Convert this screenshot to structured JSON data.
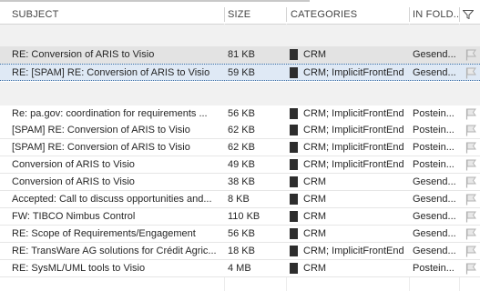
{
  "columns": {
    "subject": "SUBJECT",
    "size": "SIZE",
    "categories": "CATEGORIES",
    "in_folder": "IN FOLD..."
  },
  "rows": [
    {
      "subject": "RE: Conversion of ARIS to Visio",
      "size": "81 KB",
      "categories": "CRM",
      "folder": "Gesend...",
      "style": "grey"
    },
    {
      "subject": "RE: [SPAM]  RE: Conversion of ARIS to Visio",
      "size": "59 KB",
      "categories": "CRM; ImplicitFrontEnd",
      "folder": "Gesend...",
      "style": "selected"
    },
    {
      "subject": "Re: pa.gov: coordination for requirements ...",
      "size": "56 KB",
      "categories": "CRM; ImplicitFrontEnd",
      "folder": "Postein..."
    },
    {
      "subject": "[SPAM]  RE: Conversion of ARIS to Visio",
      "size": "62 KB",
      "categories": "CRM; ImplicitFrontEnd",
      "folder": "Postein..."
    },
    {
      "subject": "[SPAM]  RE: Conversion of ARIS to Visio",
      "size": "62 KB",
      "categories": "CRM; ImplicitFrontEnd",
      "folder": "Postein..."
    },
    {
      "subject": "Conversion of ARIS to Visio",
      "size": "49 KB",
      "categories": "CRM; ImplicitFrontEnd",
      "folder": "Postein..."
    },
    {
      "subject": "Conversion of ARIS to Visio",
      "size": "38 KB",
      "categories": "CRM",
      "folder": "Gesend..."
    },
    {
      "subject": "Accepted: Call to discuss opportunities and...",
      "size": "8 KB",
      "categories": "CRM",
      "folder": "Gesend..."
    },
    {
      "subject": "FW: TIBCO Nimbus Control",
      "size": "110 KB",
      "categories": "CRM",
      "folder": "Gesend..."
    },
    {
      "subject": "RE: Scope of Requirements/Engagement",
      "size": "56 KB",
      "categories": "CRM",
      "folder": "Gesend..."
    },
    {
      "subject": "RE: TransWare AG solutions for Crédit Agric...",
      "size": "18 KB",
      "categories": "CRM; ImplicitFrontEnd",
      "folder": "Gesend..."
    },
    {
      "subject": "RE: SysML/UML tools to Visio",
      "size": "4 MB",
      "categories": "CRM",
      "folder": "Postein..."
    }
  ],
  "colors": {
    "category_swatch": "#2d2d2d",
    "selected_row": "#dfe9f5",
    "grey_row": "#e3e3e3"
  },
  "icons": {
    "header": "filter-icon",
    "row": "flag-icon"
  }
}
